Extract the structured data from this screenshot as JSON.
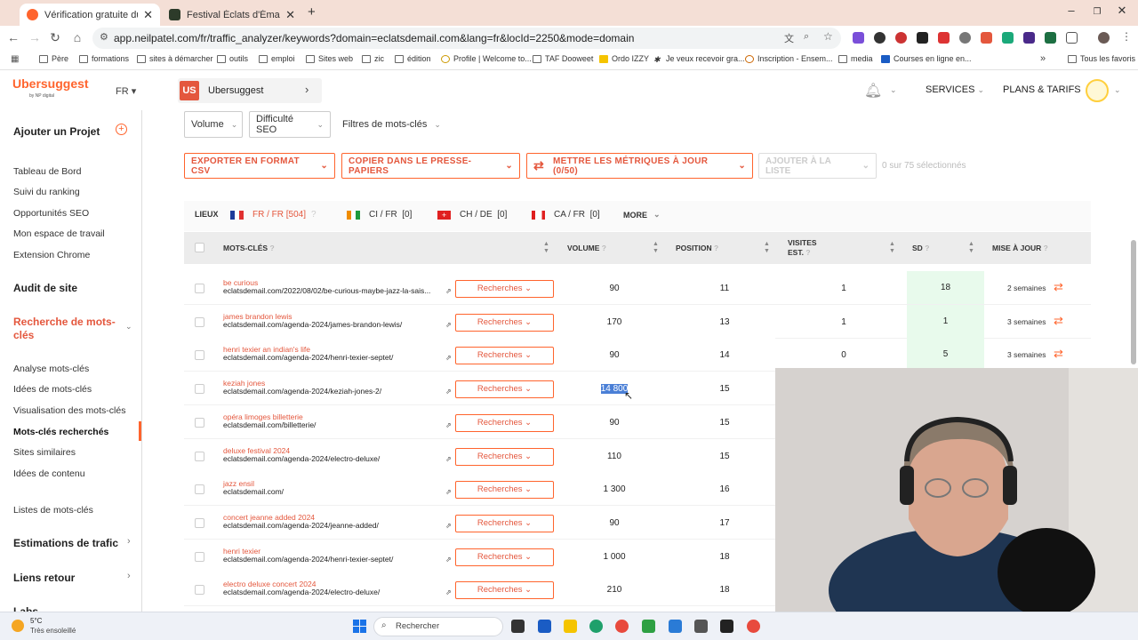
{
  "browser": {
    "tabs": [
      {
        "title": "Vérification gratuite du classem",
        "active": true
      },
      {
        "title": "Festival Éclats d'Émail Jazz Éditi",
        "active": false
      }
    ],
    "new_tab": "+",
    "url": "app.neilpatel.com/fr/traffic_analyzer/keywords?domain=eclatsdemail.com&lang=fr&locId=2250&mode=domain",
    "bookmarks": [
      "Père",
      "formations",
      "sites à démarcher",
      "outils",
      "emploi",
      "Sites web",
      "zic",
      "édition",
      "Profile | Welcome to...",
      "TAF Dooweet",
      "Ordo IZZY",
      "Je veux recevoir gra...",
      "Inscription - Ensem...",
      "media",
      "Courses en ligne en...",
      "Tous les favoris"
    ]
  },
  "header": {
    "logo": "Ubersuggest",
    "logo_sub": "by NP digital",
    "lang": "FR",
    "project_badge": "US",
    "project_name": "Ubersuggest",
    "services": "SERVICES",
    "plans": "PLANS & TARIFS"
  },
  "sidebar": {
    "add_project": "Ajouter un Projet",
    "items_top": [
      "Tableau de Bord",
      "Suivi du ranking",
      "Opportunités SEO",
      "Mon espace de travail",
      "Extension Chrome"
    ],
    "site_audit": "Audit de site",
    "keyword_research": "Recherche de mots-clés",
    "keyword_items": [
      "Analyse mots-clés",
      "Idées de mots-clés",
      "Visualisation des mots-clés",
      "Mots-clés recherchés",
      "Sites similaires",
      "Idées de contenu"
    ],
    "keyword_lists": "Listes de mots-clés",
    "traffic": "Estimations de trafic",
    "backlinks": "Liens retour",
    "labs": "Labs"
  },
  "filters": {
    "volume": "Volume",
    "difficulty": "Difficulté SEO",
    "keyword_filters": "Filtres de mots-clés"
  },
  "actions": {
    "export": "EXPORTER EN FORMAT CSV",
    "copy": "COPIER DANS LE PRESSE-PAPIERS",
    "update": "METTRE LES MÉTRIQUES À JOUR (0/50)",
    "add_list": "AJOUTER À LA LISTE",
    "selected": "0 sur 75 sélectionnés"
  },
  "locations": {
    "label": "LIEUX",
    "items": [
      {
        "name": "FR / FR",
        "count": "[504]"
      },
      {
        "name": "CI / FR",
        "count": "[0]"
      },
      {
        "name": "CH / DE",
        "count": "[0]"
      },
      {
        "name": "CA / FR",
        "count": "[0]"
      }
    ],
    "more": "MORE"
  },
  "table": {
    "headers": {
      "keywords": "MOTS-CLÉS",
      "volume": "VOLUME",
      "position": "POSITION",
      "visits": "VISITES",
      "visits2": "EST.",
      "sd": "SD",
      "update": "MISE À JOUR"
    },
    "btn_label": "Recherches",
    "rows": [
      {
        "kw": "be curious",
        "url": "eclatsdemail.com/2022/08/02/be-curious-maybe-jazz-la-sais...",
        "vol": "90",
        "pos": "11",
        "vis": "1",
        "sd": "18",
        "upd": "2 semaines"
      },
      {
        "kw": "james brandon lewis",
        "url": "eclatsdemail.com/agenda-2024/james-brandon-lewis/",
        "vol": "170",
        "pos": "13",
        "vis": "1",
        "sd": "1",
        "upd": "3 semaines"
      },
      {
        "kw": "henri texier an indian's life",
        "url": "eclatsdemail.com/agenda-2024/henri-texier-septet/",
        "vol": "90",
        "pos": "14",
        "vis": "0",
        "sd": "5",
        "upd": "3 semaines"
      },
      {
        "kw": "keziah jones",
        "url": "eclatsdemail.com/agenda-2024/keziah-jones-2/",
        "vol": "14 800",
        "pos": "15"
      },
      {
        "kw": "opéra limoges billetterie",
        "url": "eclatsdemail.com/billetterie/",
        "vol": "90",
        "pos": "15"
      },
      {
        "kw": "deluxe festival 2024",
        "url": "eclatsdemail.com/agenda-2024/electro-deluxe/",
        "vol": "110",
        "pos": "15"
      },
      {
        "kw": "jazz ensil",
        "url": "eclatsdemail.com/",
        "vol": "1 300",
        "pos": "16"
      },
      {
        "kw": "concert jeanne added 2024",
        "url": "eclatsdemail.com/agenda-2024/jeanne-added/",
        "vol": "90",
        "pos": "17"
      },
      {
        "kw": "henri texier",
        "url": "eclatsdemail.com/agenda-2024/henri-texier-septet/",
        "vol": "1 000",
        "pos": "18"
      },
      {
        "kw": "electro deluxe concert 2024",
        "url": "eclatsdemail.com/agenda-2024/electro-deluxe/",
        "vol": "210",
        "pos": "18"
      }
    ]
  },
  "taskbar": {
    "weather_temp": "5°C",
    "weather_desc": "Très ensoleillé",
    "search": "Rechercher"
  }
}
